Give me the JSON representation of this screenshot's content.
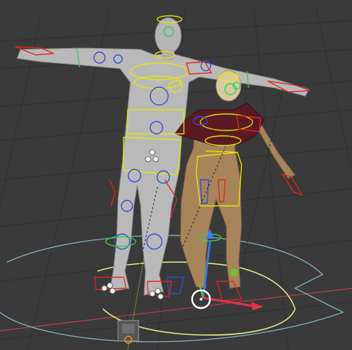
{
  "viewport": {
    "background": "#3a3a3a",
    "grid_color": "#2e2e2e",
    "x_axis_color": "#c2414b",
    "y_axis_color": "#6b8f2a"
  },
  "colors": {
    "male_skin": "#b7b7b7",
    "female_skin": "#a8845a",
    "jacket": "#5b1a22",
    "bone_ring": "#e6e600",
    "fk_control": "#2b4fd8",
    "ik_control": "#e0271d",
    "face_control": "#2fd24a",
    "root_ring": "#7fb7c7",
    "cursor_ring": "#ffffff",
    "gizmo_x": "#e8304a",
    "gizmo_z": "#3a7ce8"
  },
  "objects": [
    {
      "name": "male-character"
    },
    {
      "name": "female-character"
    },
    {
      "name": "armature-rig"
    },
    {
      "name": "camera-object"
    },
    {
      "name": "transform-gizmo"
    }
  ]
}
